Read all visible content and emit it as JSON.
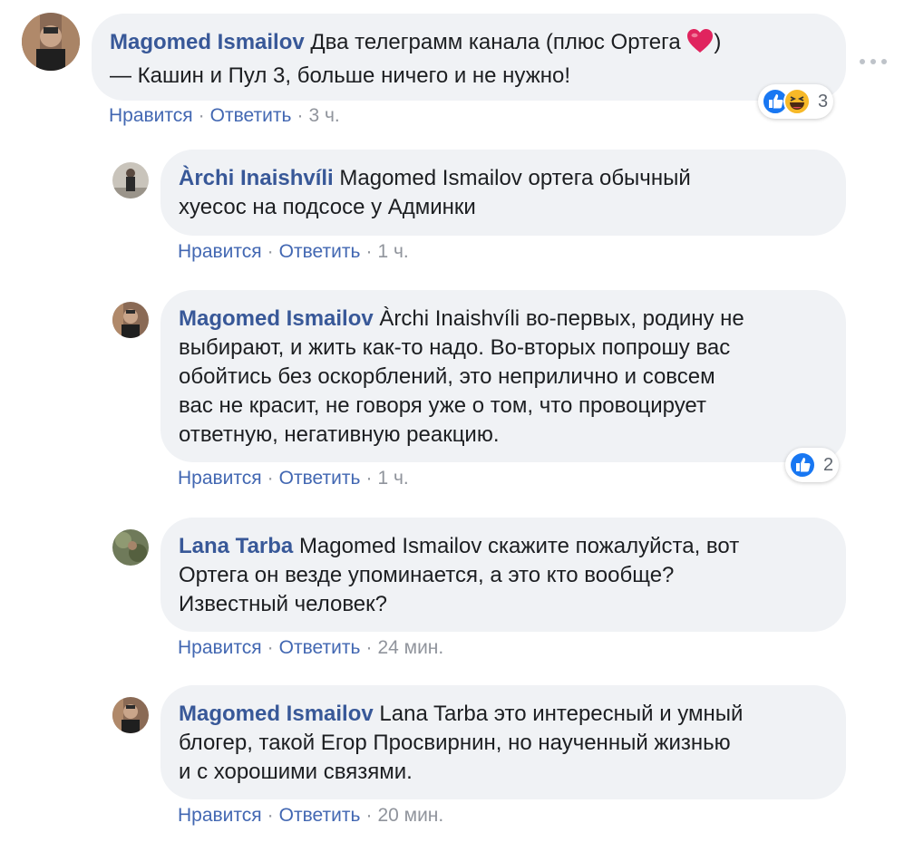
{
  "actions": {
    "like_label": "Нравится",
    "reply_label": "Ответить",
    "separator": "·"
  },
  "comments": [
    {
      "author": "Magomed Ismailov",
      "text_before_emoji": "Два телеграмм канала (плюс Ортега",
      "emoji": "heart-icon",
      "text_after_emoji": ")",
      "line2": "— Кашин и Пул 3, больше ничего и не нужно!",
      "time": "3 ч.",
      "reactions": {
        "icons": [
          "like-icon",
          "haha-icon"
        ],
        "count": "3"
      }
    },
    {
      "author": "Àrchi Inaishvíli",
      "mention": "Magomed Ismailov",
      "line1_rest": "ортега обычный",
      "line2": "хуесос на подсосе у Админки",
      "time": "1 ч."
    },
    {
      "author": "Magomed Ismailov",
      "mention": "Àrchi Inaishvíli",
      "line1_rest": "во-первых, родину не",
      "line2": "выбирают, и жить как-то надо. Во-вторых попрошу вас",
      "line3": "обойтись без оскорблений, это неприлично и совсем",
      "line4": "вас не красит, не говоря уже о том, что провоцирует",
      "line5": "ответную, негативную реакцию.",
      "time": "1 ч.",
      "reactions": {
        "icons": [
          "like-icon"
        ],
        "count": "2"
      }
    },
    {
      "author": "Lana Tarba",
      "mention": "Magomed Ismailov",
      "line1_rest": "скажите пожалуйста, вот",
      "line2": "Ортега он везде упоминается, а это кто вообще?",
      "line3": "Известный человек?",
      "time": "24 мин."
    },
    {
      "author": "Magomed Ismailov",
      "mention": "Lana Tarba",
      "line1_rest": "это интересный и умный",
      "line2": "блогер, такой Егор Просвирнин, но наученный жизнью",
      "line3": "и с хорошими связями.",
      "time": "20 мин."
    }
  ],
  "colors": {
    "author": "#385898",
    "link": "#4267b2",
    "bubble": "#f0f2f5",
    "meta": "#90949c",
    "like_blue": "#1877f2",
    "heart_red": "#e0245e"
  }
}
